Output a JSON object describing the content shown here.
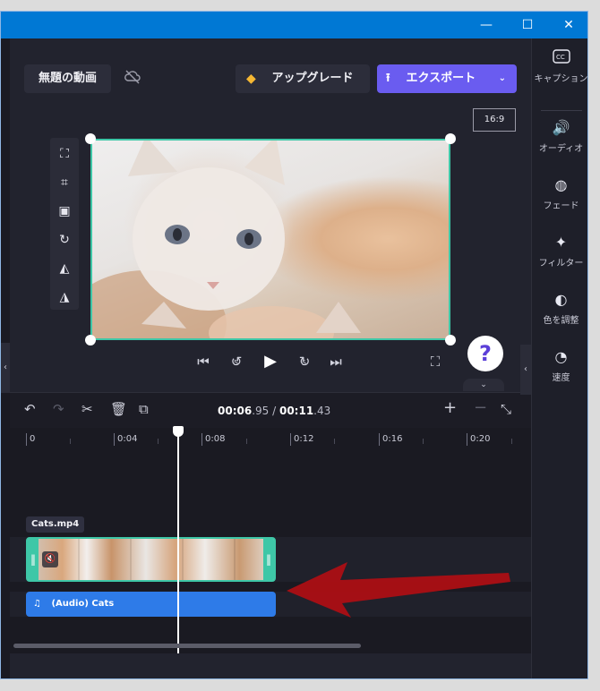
{
  "window": {
    "min": "—",
    "max": "☐",
    "close": "✕"
  },
  "header": {
    "project_title": "無題の動画",
    "upgrade_label": "アップグレード",
    "export_label": "エクスポート",
    "aspect_ratio": "16:9"
  },
  "right_panel": {
    "items": [
      {
        "label": "キャプション",
        "icon": "captions-icon"
      },
      {
        "label": "オーディオ",
        "icon": "speaker-icon"
      },
      {
        "label": "フェード",
        "icon": "fade-icon"
      },
      {
        "label": "フィルター",
        "icon": "magic-wand-icon"
      },
      {
        "label": "色を調整",
        "icon": "contrast-icon"
      },
      {
        "label": "速度",
        "icon": "speedometer-icon"
      }
    ]
  },
  "playback": {
    "time_current": "00:06",
    "time_current_frac": ".95",
    "time_separator": " / ",
    "time_total": "00:11",
    "time_total_frac": ".43",
    "skip_back_seconds": "5",
    "skip_fwd_seconds": "5"
  },
  "help_label": "?",
  "timeline": {
    "ruler_labels": [
      "0",
      "0:04",
      "0:08",
      "0:12",
      "0:16",
      "0:20"
    ],
    "video_clip_name": "Cats.mp4",
    "audio_clip_name": "(Audio) Cats"
  },
  "colors": {
    "accent": "#6a5cf0",
    "selection": "#3ec7a7",
    "audio_track": "#2e7be8",
    "titlebar": "#0078d4",
    "annotation_arrow": "#b00e14"
  }
}
